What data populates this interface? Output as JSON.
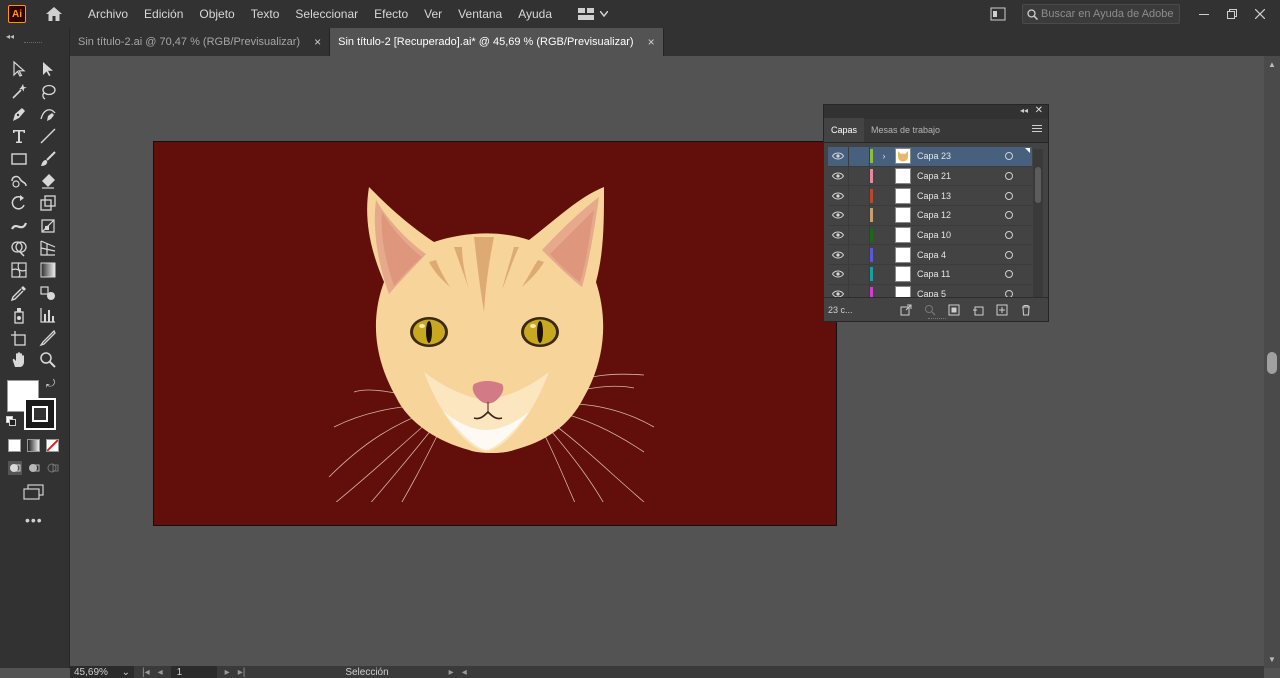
{
  "app": {
    "logo_text": "Ai"
  },
  "menu": {
    "items": [
      "Archivo",
      "Edición",
      "Objeto",
      "Texto",
      "Seleccionar",
      "Efecto",
      "Ver",
      "Ventana",
      "Ayuda"
    ]
  },
  "search": {
    "placeholder": "Buscar en Ayuda de Adobe"
  },
  "tabs": [
    {
      "label": "Sin título-2.ai @ 70,47 % (RGB/Previsualizar)",
      "active": false
    },
    {
      "label": "Sin título-2 [Recuperado].ai* @ 45,69 % (RGB/Previsualizar)",
      "active": true
    }
  ],
  "tab_close_glyph": "×",
  "toolbar": {
    "tools": [
      "selection-tool",
      "direct-selection-tool",
      "magic-wand-tool",
      "lasso-tool",
      "pen-tool",
      "curvature-tool",
      "type-tool",
      "line-segment-tool",
      "rectangle-tool",
      "paintbrush-tool",
      "shaper-tool",
      "eraser-tool",
      "rotate-tool",
      "scale-tool",
      "width-tool",
      "free-transform-tool",
      "shape-builder-tool",
      "perspective-grid-tool",
      "mesh-tool",
      "gradient-tool",
      "eyedropper-tool",
      "blend-tool",
      "symbol-sprayer-tool",
      "column-graph-tool",
      "artboard-tool",
      "slice-tool",
      "hand-tool",
      "zoom-tool"
    ],
    "fill_color": "#ffffff",
    "stroke_color": "#1b1b1b",
    "more_label": "•••"
  },
  "canvas": {
    "background_color": "#535353",
    "artboard_color": "#620e0b"
  },
  "layers_panel": {
    "tabs": [
      {
        "label": "Capas",
        "active": true
      },
      {
        "label": "Mesas de trabajo",
        "active": false
      }
    ],
    "layers": [
      {
        "name": "Capa 23",
        "color": "#8fbc3c",
        "selected": true,
        "has_art": true
      },
      {
        "name": "Capa 21",
        "color": "#e58a9a",
        "selected": false,
        "has_art": false
      },
      {
        "name": "Capa 13",
        "color": "#b84a2a",
        "selected": false,
        "has_art": false
      },
      {
        "name": "Capa 12",
        "color": "#c8a070",
        "selected": false,
        "has_art": false
      },
      {
        "name": "Capa 10",
        "color": "#1a6a1a",
        "selected": false,
        "has_art": false
      },
      {
        "name": "Capa 4",
        "color": "#5a5ad8",
        "selected": false,
        "has_art": false
      },
      {
        "name": "Capa 11",
        "color": "#1aa0a0",
        "selected": false,
        "has_art": false
      },
      {
        "name": "Capa 5",
        "color": "#d040d0",
        "selected": false,
        "has_art": false
      }
    ],
    "count_label": "23 c..."
  },
  "statusbar": {
    "zoom": "45,69%",
    "artboard_number": "1",
    "status": "Selección"
  }
}
